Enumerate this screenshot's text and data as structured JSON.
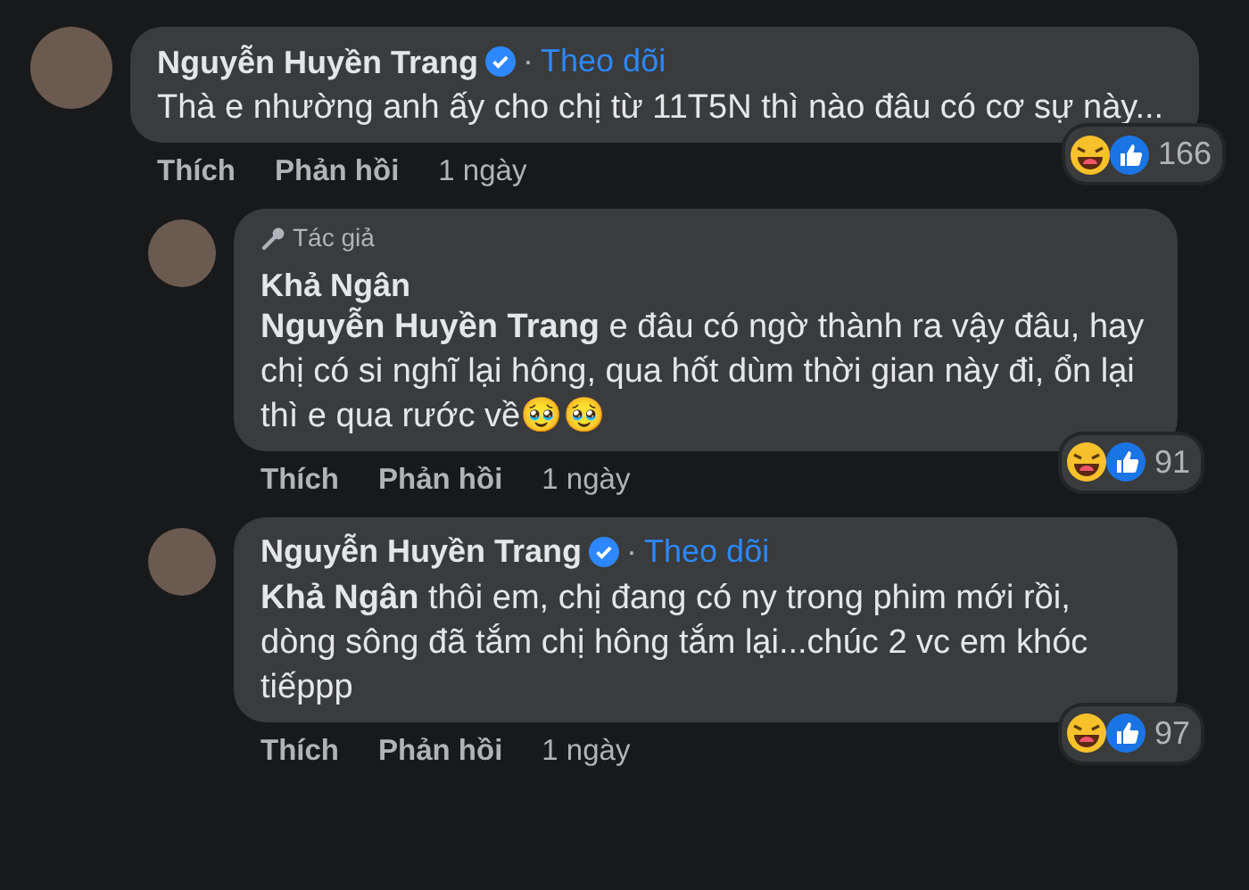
{
  "comments": [
    {
      "author": "Nguyễn Huyền Trang",
      "verified": true,
      "separator": "·",
      "follow": "Theo dõi",
      "text": "Thà e nhường anh ấy cho chị từ 11T5N thì nào đâu có cơ sự này...",
      "reaction_count": "166",
      "actions": {
        "like": "Thích",
        "reply": "Phản hồi",
        "time": "1 ngày"
      },
      "children": [
        {
          "badge": "Tác giả",
          "author": "Khả Ngân",
          "verified": false,
          "text": "**Nguyễn Huyền Trang** e đâu có ngờ thành ra vậy đâu, hay chị có si nghĩ lại hông, qua hốt dùm thời gian này đi, ổn lại thì e qua rước về🥹🥹",
          "reaction_count": "91",
          "actions": {
            "like": "Thích",
            "reply": "Phản hồi",
            "time": "1 ngày"
          }
        },
        {
          "author": "Nguyễn Huyền Trang",
          "verified": true,
          "separator": "·",
          "follow": "Theo dõi",
          "text": "**Khả Ngân** thôi em, chị đang có ny trong phim mới rồi, dòng sông đã tắm chị hông tắm lại...chúc 2 vc em khóc tiếppp",
          "reaction_count": "97",
          "actions": {
            "like": "Thích",
            "reply": "Phản hồi",
            "time": "1 ngày"
          }
        }
      ]
    }
  ]
}
